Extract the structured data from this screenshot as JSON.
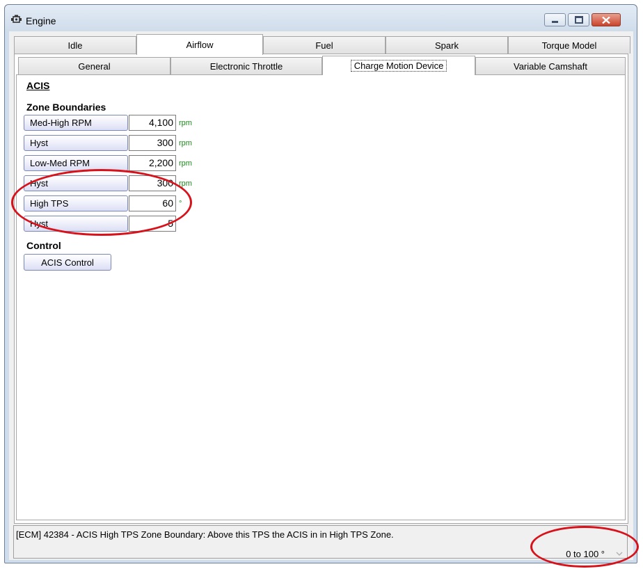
{
  "window": {
    "title": "Engine"
  },
  "tabs": [
    "Idle",
    "Airflow",
    "Fuel",
    "Spark",
    "Torque Model"
  ],
  "subtabs": [
    "General",
    "Electronic Throttle",
    "Charge Motion Device",
    "Variable Camshaft"
  ],
  "page": {
    "acis_heading": "ACIS",
    "zone_heading": "Zone Boundaries",
    "rows": [
      {
        "label": "Med-High RPM",
        "value": "4,100",
        "unit": "rpm"
      },
      {
        "label": "Hyst",
        "value": "300",
        "unit": "rpm"
      },
      {
        "label": "Low-Med RPM",
        "value": "2,200",
        "unit": "rpm"
      },
      {
        "label": "Hyst",
        "value": "300",
        "unit": "rpm"
      },
      {
        "label": "High TPS",
        "value": "60",
        "unit": "°"
      },
      {
        "label": "Hyst",
        "value": "5",
        "unit": ""
      }
    ],
    "control_heading": "Control",
    "control_button": "ACIS Control"
  },
  "status": {
    "message": "[ECM] 42384 - ACIS High TPS Zone Boundary: Above this TPS the ACIS in in High TPS Zone.",
    "range": "0 to 100 °"
  },
  "colors": {
    "annotation": "#d8121b",
    "unit_text": "#1a8a1a"
  }
}
